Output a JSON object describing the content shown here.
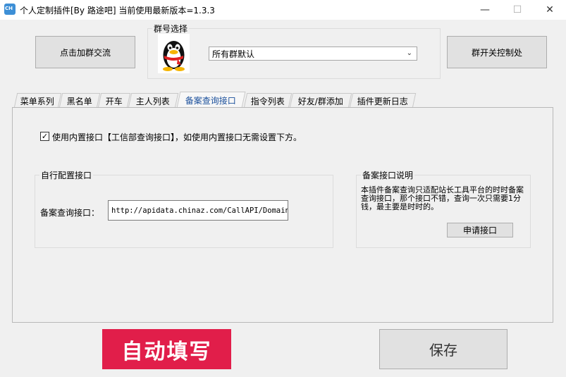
{
  "window": {
    "title": "个人定制插件[By 路途吧]   当前使用最新版本=1.3.3",
    "icon_name": "app-icon",
    "icon_text": "CH",
    "controls": {
      "minimize": "—",
      "maximize": "☐",
      "close": "✕"
    }
  },
  "top": {
    "join_group_button": "点击加群交流",
    "group_select_label": "群号选择",
    "group_select_value": "所有群默认",
    "group_switch_button": "群开关控制处",
    "avatar_icon": "qq-penguin-icon"
  },
  "tabs": [
    {
      "label": "菜单系列"
    },
    {
      "label": "黑名单"
    },
    {
      "label": "开车"
    },
    {
      "label": "主人列表"
    },
    {
      "label": "备案查询接口"
    },
    {
      "label": "指令列表"
    },
    {
      "label": "好友/群添加"
    },
    {
      "label": "插件更新日志"
    }
  ],
  "active_tab": "备案查询接口",
  "panel": {
    "builtin_checkbox_checked": true,
    "builtin_checkbox_label": "使用内置接口【工信部查询接口】，如使用内置接口无需设置下方。",
    "custom_group_label": "自行配置接口",
    "query_api_label": "备案查询接口：",
    "query_api_value": "http://apidata.chinaz.com/CallAPI/Domain?k",
    "info_group_label": "备案接口说明",
    "info_text": "本插件备案查询只适配站长工具平台的时时备案查询接口，那个接口不错，查询一次只需要1分钱，最主要是时时的。",
    "apply_button": "申请接口"
  },
  "bottom": {
    "banner_text": "自动填写",
    "save_button": "保存"
  },
  "colors": {
    "banner": "#e11e4a",
    "active_tab_text": "#1a4f9b"
  }
}
